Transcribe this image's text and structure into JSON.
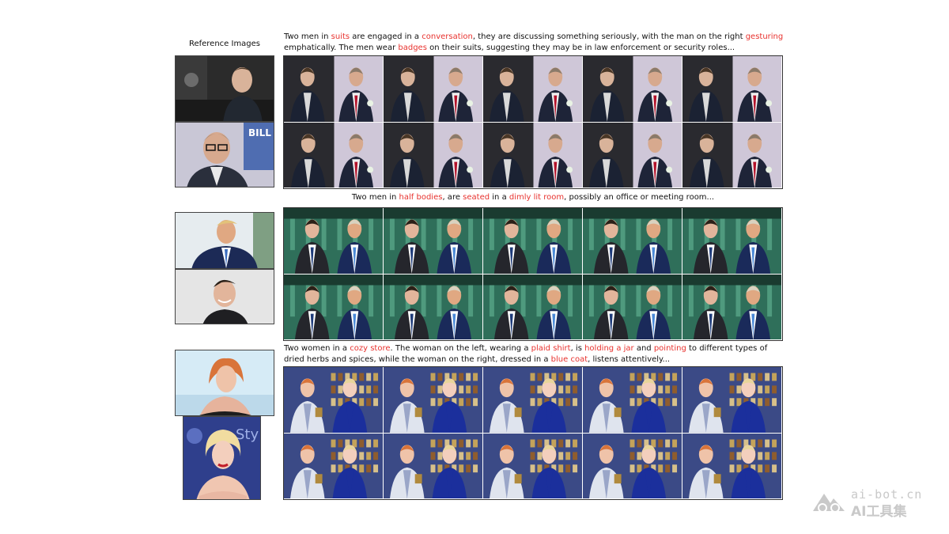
{
  "reference_title": "Reference Images",
  "sections": [
    {
      "caption_segments": [
        {
          "text": "Two men in ",
          "hl": false
        },
        {
          "text": "suits",
          "hl": true
        },
        {
          "text": " are engaged in a ",
          "hl": false
        },
        {
          "text": "conversation",
          "hl": true
        },
        {
          "text": ", they are discussing something seriously, with the man on the right ",
          "hl": false
        },
        {
          "text": "gesturing",
          "hl": true
        },
        {
          "text": "\n",
          "hl": false
        },
        {
          "text": "emphatically. The men wear ",
          "hl": false
        },
        {
          "text": "badges",
          "hl": true
        },
        {
          "text": " on their suits, suggesting they may be in law enforcement or security roles...",
          "hl": false
        }
      ],
      "scene": "office"
    },
    {
      "caption_segments": [
        {
          "text": "Two men in ",
          "hl": false
        },
        {
          "text": "half bodies",
          "hl": true
        },
        {
          "text": ", are ",
          "hl": false
        },
        {
          "text": "seated",
          "hl": true
        },
        {
          "text": " in a ",
          "hl": false
        },
        {
          "text": "dimly lit room",
          "hl": true
        },
        {
          "text": ", possibly an office or meeting room...",
          "hl": false
        }
      ],
      "scene": "green-room"
    },
    {
      "caption_segments": [
        {
          "text": "Two women in a ",
          "hl": false
        },
        {
          "text": "cozy store",
          "hl": true
        },
        {
          "text": ". The woman on the left, wearing a ",
          "hl": false
        },
        {
          "text": "plaid shirt",
          "hl": true
        },
        {
          "text": ", is ",
          "hl": false
        },
        {
          "text": "holding a jar",
          "hl": true
        },
        {
          "text": " and ",
          "hl": false
        },
        {
          "text": "pointing",
          "hl": true
        },
        {
          "text": " to different types of",
          "hl": false
        },
        {
          "text": "\n",
          "hl": false
        },
        {
          "text": "dried herbs and spices, while the woman on the right, dressed in a ",
          "hl": false
        },
        {
          "text": "blue coat",
          "hl": true
        },
        {
          "text": ", listens attentively...",
          "hl": false
        }
      ],
      "scene": "store"
    }
  ],
  "reference_image_text": {
    "banner": "BILL",
    "backdrop": "Sty"
  },
  "colors": {
    "highlight": "#e8322e",
    "watermark": "#c9c9c9"
  },
  "watermark": {
    "url": "ai-bot.cn",
    "name": "AI工具集"
  }
}
